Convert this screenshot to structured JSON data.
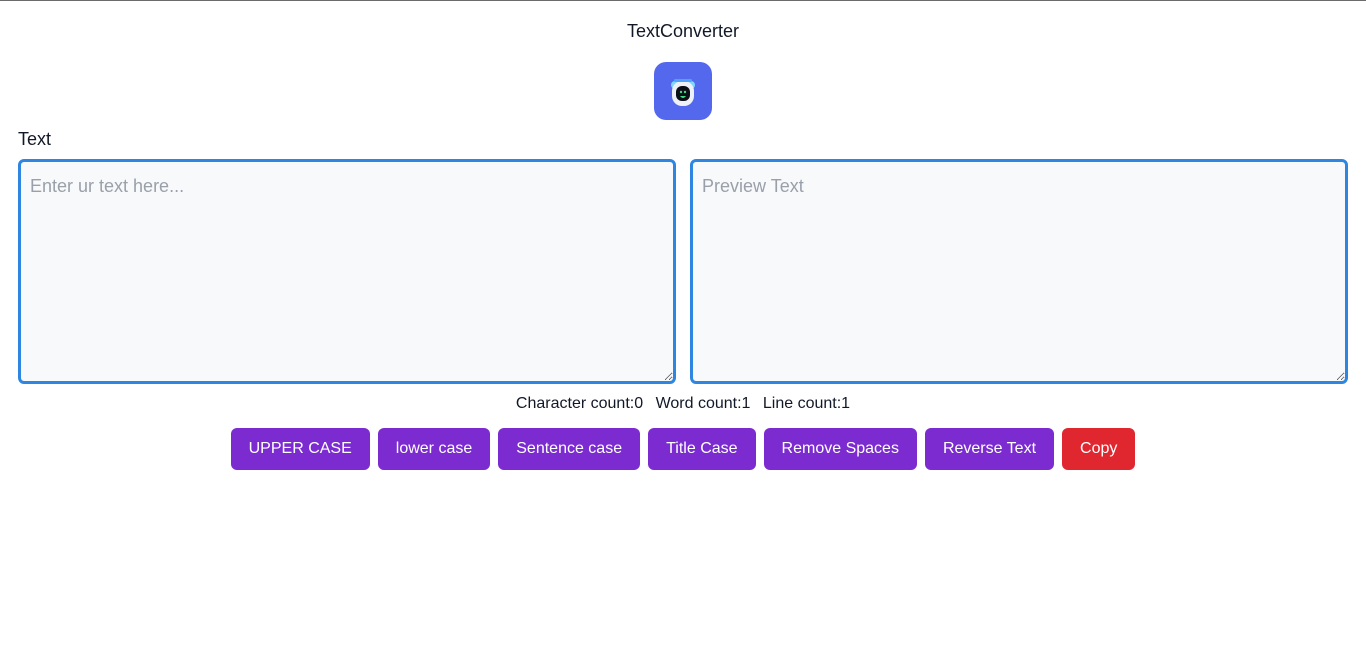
{
  "app": {
    "title": "TextConverter",
    "logo_icon": "robot-icon"
  },
  "input": {
    "label": "Text",
    "placeholder": "Enter ur text here...",
    "value": ""
  },
  "preview": {
    "placeholder": "Preview Text",
    "value": ""
  },
  "counts": {
    "character": "Character count:0",
    "word": "Word count:1",
    "line": "Line count:1"
  },
  "buttons": [
    {
      "label": "UPPER CASE"
    },
    {
      "label": "lower case"
    },
    {
      "label": "Sentence case"
    },
    {
      "label": "Title Case"
    },
    {
      "label": "Remove Spaces"
    },
    {
      "label": "Reverse Text"
    },
    {
      "label": "Copy"
    }
  ],
  "colors": {
    "primary": "#7b2bcf",
    "danger": "#e0262f",
    "focus_border": "#2f86e0",
    "logo_bg": "#5468ee"
  }
}
